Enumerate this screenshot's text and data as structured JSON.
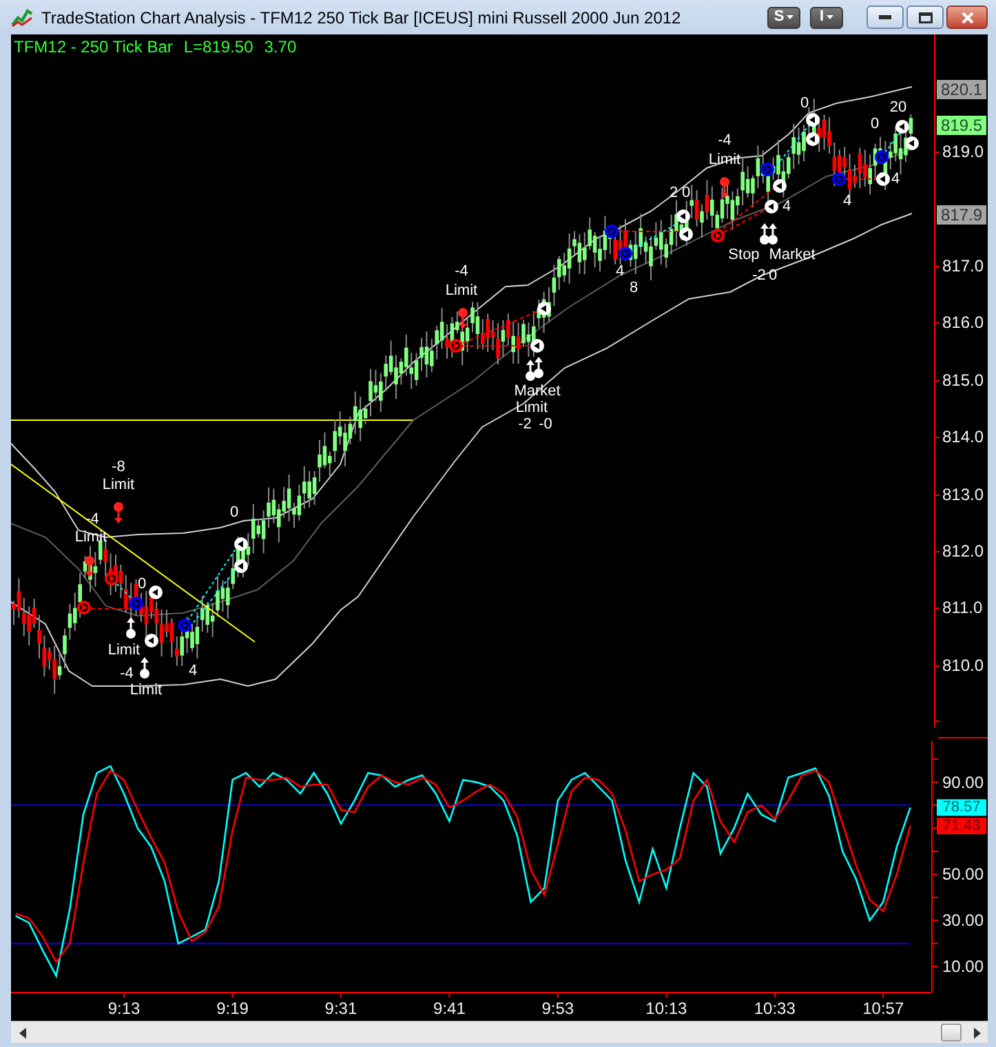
{
  "window": {
    "title": "TradeStation Chart Analysis - TFM12 250 Tick Bar [ICEUS] mini Russell 2000 Jun 2012",
    "menu_buttons": [
      {
        "label": "S"
      },
      {
        "label": "I"
      }
    ]
  },
  "chart": {
    "status": {
      "symbol": "TFM12 - 250 Tick Bar",
      "last": "L=819.50",
      "change": "3.70"
    },
    "price_panel": {
      "axis_labels": [
        "819.0",
        "817.0",
        "816.0",
        "815.0",
        "814.0",
        "813.0",
        "812.0",
        "811.0",
        "810.0"
      ],
      "badges": [
        {
          "text": "820.1",
          "color": "#a4a4a4"
        },
        {
          "text": "819.5",
          "color": "#80ff80"
        },
        {
          "text": "817.9",
          "color": "#a4a4a4"
        }
      ],
      "trade_labels": [
        "-8",
        "Limit",
        "-4",
        "Limit",
        "0",
        "0",
        "Limit",
        "-4",
        "Limit",
        "4",
        "-4",
        "Limit",
        "Market",
        "Limit",
        "-2",
        "-0",
        "4",
        "8",
        "2",
        "0",
        "-4",
        "Limit",
        "4",
        "Stop",
        "Market",
        "-2",
        "0",
        "0",
        "4",
        "0",
        "4",
        "20"
      ]
    },
    "oscillator": {
      "badges": [
        {
          "text": "78.57",
          "color": "#00ffff"
        },
        {
          "text": "71.43",
          "color": "#ff0000"
        }
      ],
      "chart_data": {
        "type": "line",
        "categories": [
          null,
          null,
          null,
          null,
          null,
          null,
          null,
          null,
          "9:13",
          null,
          null,
          null,
          null,
          null,
          null,
          null,
          "9:19",
          null,
          null,
          null,
          null,
          null,
          null,
          null,
          "9:31",
          null,
          null,
          null,
          null,
          null,
          null,
          null,
          "9:41",
          null,
          null,
          null,
          null,
          null,
          null,
          null,
          "9:53",
          null,
          null,
          null,
          null,
          null,
          null,
          null,
          "10:13",
          null,
          null,
          null,
          null,
          null,
          null,
          null,
          "10:33",
          null,
          null,
          null,
          null,
          null,
          null,
          null,
          "10:57",
          null,
          null
        ],
        "series": [
          {
            "color": "#00ffff",
            "values": [
              32,
              29,
              17,
              6,
              35,
              76,
              94,
              97,
              85,
              70,
              62,
              47,
              20,
              23,
              26,
              47,
              91,
              94,
              88,
              94,
              91,
              85,
              94,
              85,
              72,
              82,
              94,
              93,
              88,
              91,
              93,
              85,
              73,
              91,
              90,
              88,
              82,
              67,
              38,
              44,
              82,
              91,
              94,
              88,
              82,
              56,
              38,
              61,
              44,
              70,
              94,
              88,
              59,
              70,
              85,
              76,
              73,
              92,
              94,
              96,
              84,
              60,
              48,
              30,
              38,
              62,
              79
            ]
          },
          {
            "color": "#ff0000",
            "values": [
              33,
              31,
              23,
              12,
              20,
              55,
              85,
              95,
              91,
              78,
              66,
              55,
              34,
              21,
              25,
              36,
              69,
              92,
              91,
              91,
              92,
              88,
              89,
              89,
              78,
              77,
              88,
              93,
              90,
              89,
              92,
              89,
              79,
              82,
              86,
              89,
              85,
              75,
              52,
              41,
              63,
              86,
              92,
              91,
              85,
              69,
              47,
              50,
              52,
              57,
              82,
              91,
              73,
              64,
              77,
              80,
              74,
              82,
              93,
              95,
              90,
              72,
              54,
              39,
              34,
              50,
              71
            ]
          }
        ],
        "ylim": [
          -1,
          109
        ],
        "yticks": [
          {
            "value": 10,
            "label": "10.00"
          },
          {
            "value": 30,
            "label": "30.00"
          },
          {
            "value": 50,
            "label": "50.00"
          },
          {
            "value": 90,
            "label": "90.00"
          }
        ],
        "ref_lines": [
          {
            "axis": "y",
            "value": 80
          },
          {
            "axis": "y",
            "value": 20
          }
        ]
      }
    }
  }
}
